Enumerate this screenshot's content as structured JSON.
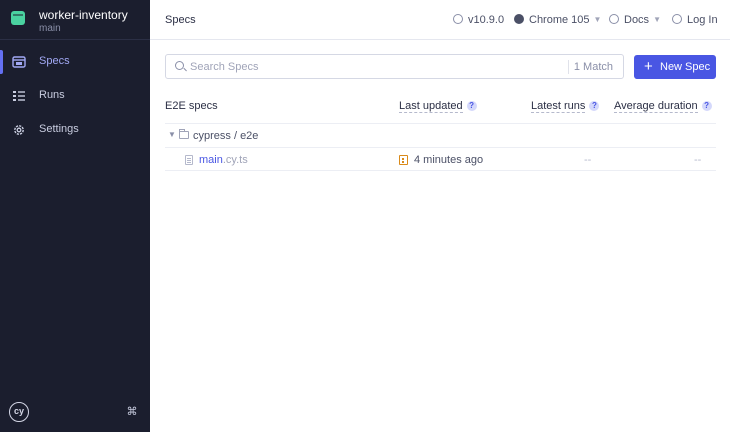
{
  "sidebar": {
    "project_name": "worker-inventory",
    "branch": "main",
    "items": [
      {
        "label": "Specs",
        "icon": "specs-icon",
        "active": true
      },
      {
        "label": "Runs",
        "icon": "runs-icon",
        "active": false
      },
      {
        "label": "Settings",
        "icon": "gear-icon",
        "active": false
      }
    ],
    "logo_text": "cy",
    "shortcut_symbol": "⌘"
  },
  "header": {
    "title": "Specs",
    "version": "v10.9.0",
    "browser": "Chrome 105",
    "docs": "Docs",
    "login": "Log In"
  },
  "search": {
    "placeholder": "Search Specs",
    "match_count": "1 Match"
  },
  "new_spec_label": "New Spec",
  "table": {
    "columns": {
      "specs": "E2E specs",
      "last_updated": "Last updated",
      "latest_runs": "Latest runs",
      "average_duration": "Average duration"
    },
    "help_glyph": "?",
    "folder": "cypress / e2e",
    "spec": {
      "name": "main",
      "ext": ".cy.ts",
      "last_updated": "4 minutes ago",
      "latest_runs": "--",
      "average_duration": "--"
    }
  },
  "colors": {
    "sidebar_bg": "#1b1e2e",
    "accent": "#4956e3",
    "active_nav": "#a2a9f5",
    "logo": "#4ad2a0"
  }
}
